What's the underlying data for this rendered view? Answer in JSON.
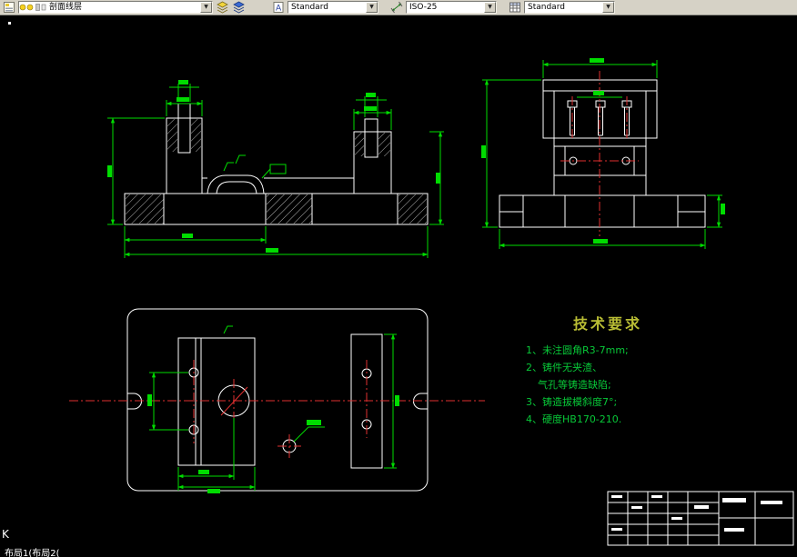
{
  "toolbar": {
    "layer_combo": "剖面线层",
    "text_style_combo": "Standard",
    "dim_style_combo": "ISO-25",
    "table_style_combo": "Standard",
    "dropdown_glyph": "▼"
  },
  "canvas": {
    "tech": {
      "title": "技术要求",
      "lines": [
        "1、未注圆角R3-7mm;",
        "2、铸件无夹渣、",
        "气孔等铸造缺陷;",
        "3、铸造拔模斜度7°;",
        "4、硬度HB170-210."
      ]
    },
    "corner_label": "K"
  },
  "statusbar": {
    "tabs": "布局1(布局2("
  },
  "colors": {
    "object_line": "#ffffff",
    "dimension": "#00dc00",
    "centerline": "#e03030",
    "tech_title": "#b8bc34",
    "tech_text": "#08c838",
    "toolbar_bg": "#d6d2c6",
    "canvas_bg": "#000000"
  },
  "icons": {
    "layer_list": "document-with-layers",
    "layer_properties": "layer-stack-yellow",
    "layer_states": "layer-stack-blue",
    "text_style": "document-letter-A",
    "dim_style": "dimension-line-arrows",
    "table_style": "table-grid",
    "layer_state_bulbs": "yellow-bulb-sun-swatch"
  }
}
